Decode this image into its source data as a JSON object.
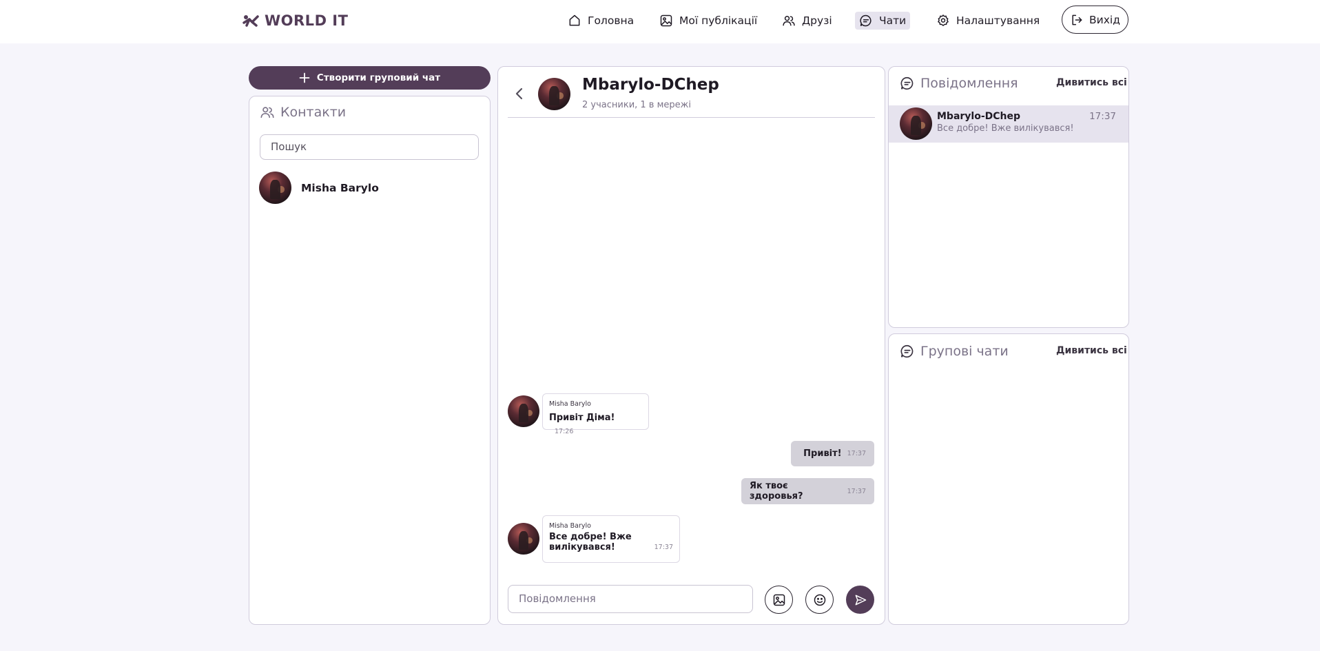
{
  "header": {
    "logo_text": "WORLD IT",
    "nav": {
      "home": "Головна",
      "publications": "Мої публікації",
      "friends": "Друзі",
      "chats": "Чати",
      "settings": "Налаштування"
    },
    "logout": "Вихід"
  },
  "contacts": {
    "create_group_label": "Створити груповий чат",
    "title": "Контакти",
    "search_placeholder": "Пошук",
    "items": [
      {
        "name": "Misha Barylo"
      }
    ]
  },
  "chat": {
    "title": "Mbarylo-DChep",
    "subtitle": "2 учасники, 1 в мережі",
    "messages": [
      {
        "direction": "in",
        "sender": "Misha Barylo",
        "text": "Привіт Діма!",
        "time": "17:26"
      },
      {
        "direction": "out",
        "text": "Привіт!",
        "time": "17:37"
      },
      {
        "direction": "out",
        "text": "Як твоє здоровья?",
        "time": "17:37"
      },
      {
        "direction": "in",
        "sender": "Misha Barylo",
        "text_line1": "Все добре! Вже",
        "text_line2": "вилікувався!",
        "time": "17:37"
      }
    ],
    "input_placeholder": "Повідомлення"
  },
  "messages_panel": {
    "title": "Повідомлення",
    "see_all": "Дивитись всі",
    "items": [
      {
        "name": "Mbarylo-DChep",
        "time": "17:37",
        "preview": "Все добре! Вже вилікувався!"
      }
    ]
  },
  "groups_panel": {
    "title": "Групові чати",
    "see_all": "Дивитись всі"
  },
  "colors": {
    "accent": "#533d58",
    "background": "#f6f5fb",
    "active_highlight": "#e6e3ee"
  }
}
